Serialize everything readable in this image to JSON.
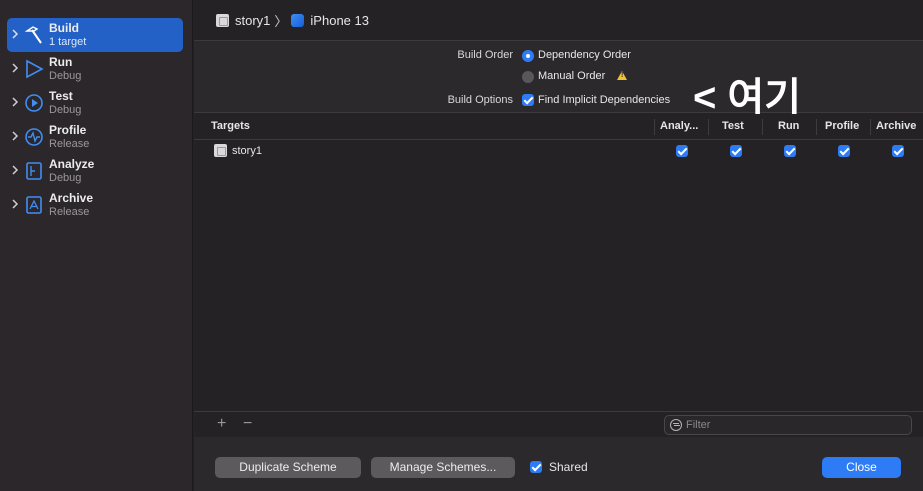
{
  "sidebar": {
    "items": [
      {
        "title": "Build",
        "subtitle": "1 target",
        "icon": "hammer-icon"
      },
      {
        "title": "Run",
        "subtitle": "Debug",
        "icon": "play-icon"
      },
      {
        "title": "Test",
        "subtitle": "Debug",
        "icon": "test-diamond-icon"
      },
      {
        "title": "Profile",
        "subtitle": "Release",
        "icon": "waveform-icon"
      },
      {
        "title": "Analyze",
        "subtitle": "Debug",
        "icon": "analyze-icon"
      },
      {
        "title": "Archive",
        "subtitle": "Release",
        "icon": "archive-icon"
      }
    ]
  },
  "breadcrumb": {
    "project": "story1",
    "device": "iPhone 13"
  },
  "options": {
    "build_order_label": "Build Order",
    "dependency_order": "Dependency Order",
    "manual_order": "Manual Order",
    "build_options_label": "Build Options",
    "find_implicit": "Find Implicit Dependencies"
  },
  "annotation": "< 여기",
  "table": {
    "headers": [
      "Targets",
      "Analy...",
      "Test",
      "Run",
      "Profile",
      "Archive"
    ],
    "rows": [
      {
        "name": "story1",
        "analyze": true,
        "test": true,
        "run": true,
        "profile": true,
        "archive": true
      }
    ]
  },
  "filter": {
    "placeholder": "Filter"
  },
  "footer": {
    "duplicate": "Duplicate Scheme",
    "manage": "Manage Schemes...",
    "shared": "Shared",
    "close": "Close"
  },
  "colors": {
    "accent": "#2d7cf6",
    "selection": "#2461c6",
    "warning": "#f0c430"
  }
}
